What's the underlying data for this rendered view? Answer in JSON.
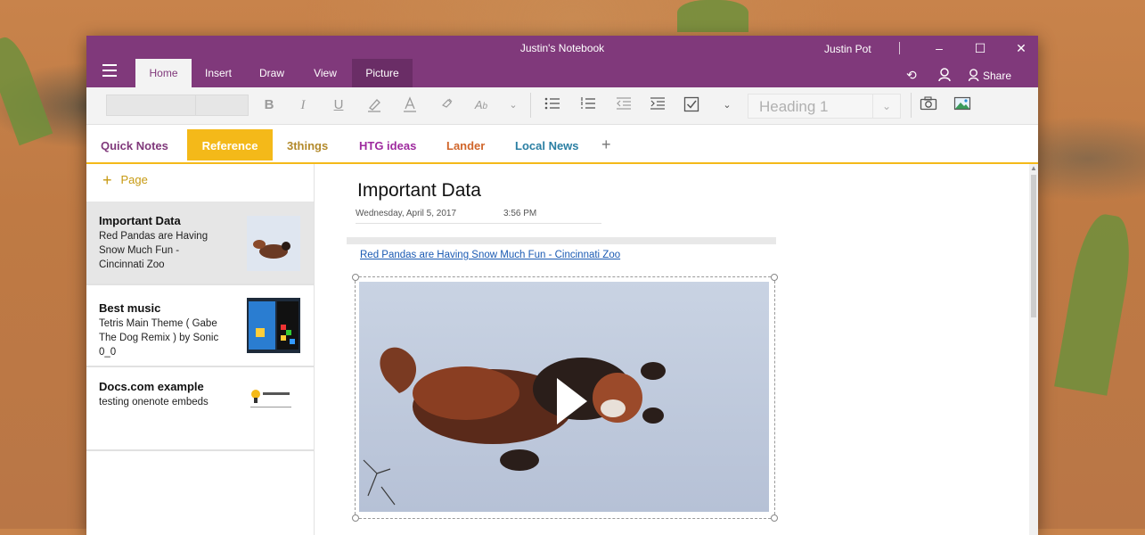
{
  "window": {
    "title": "Justin's Notebook",
    "user": "Justin Pot",
    "minimize": "–",
    "maximize": "☐",
    "close": "✕"
  },
  "tabs": [
    {
      "label": "Home"
    },
    {
      "label": "Insert"
    },
    {
      "label": "Draw"
    },
    {
      "label": "View"
    },
    {
      "label": "Picture"
    }
  ],
  "title_actions": {
    "undo": "⟲",
    "account": "⚇",
    "share": "Share"
  },
  "ribbon": {
    "bold": "B",
    "italic": "I",
    "underline": "U",
    "style_value": "Heading 1",
    "style_chevron": "⌄",
    "more_chevron": "⌄"
  },
  "sections": [
    {
      "label": "Quick Notes",
      "color": "#80397b"
    },
    {
      "label": "Reference",
      "color": "#ffffff"
    },
    {
      "label": "3things",
      "color": "#b38a2b"
    },
    {
      "label": "HTG ideas",
      "color": "#9e2a9e"
    },
    {
      "label": "Lander",
      "color": "#d0652a"
    },
    {
      "label": "Local News",
      "color": "#2b7fa3"
    }
  ],
  "add_section": "+",
  "pages": {
    "add_label": "Page",
    "items": [
      {
        "title": "Important Data",
        "snippet": "Red Pandas are Having Snow Much Fun - Cincinnati Zoo"
      },
      {
        "title": "Best music",
        "snippet": "Tetris Main Theme ( Gabe The Dog Remix ) by Sonic 0_0"
      },
      {
        "title": "Docs.com example",
        "snippet": "testing onenote embeds"
      }
    ]
  },
  "note": {
    "title": "Important Data",
    "date": "Wednesday, April 5, 2017",
    "time": "3:56 PM",
    "link_text": "Red Pandas are Having Snow Much Fun - Cincinnati Zoo"
  },
  "colors": {
    "brand": "#80397b",
    "section_accent": "#f4b919"
  },
  "icons": [
    "menu-icon",
    "highlighter-icon",
    "font-color-icon",
    "clear-format-icon",
    "styles-icon",
    "bullet-list-icon",
    "numbered-list-icon",
    "outdent-icon",
    "indent-icon",
    "checkbox-icon",
    "camera-icon",
    "picture-icon",
    "play-icon"
  ]
}
